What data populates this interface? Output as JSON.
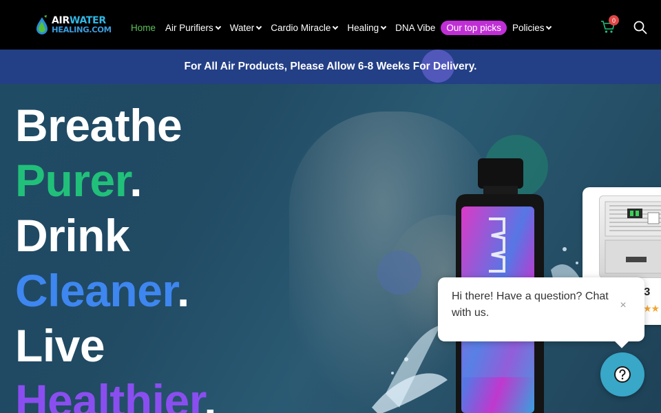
{
  "logo": {
    "line1_a": "AIR",
    "line1_b": "WATER",
    "line2": "HEALING.COM"
  },
  "nav": {
    "items": [
      {
        "label": "Home",
        "active": true,
        "dropdown": false
      },
      {
        "label": "Air Purifiers",
        "dropdown": true
      },
      {
        "label": "Water",
        "dropdown": true
      },
      {
        "label": "Cardio Miracle",
        "dropdown": true
      },
      {
        "label": "Healing",
        "dropdown": true
      },
      {
        "label": "DNA Vibe",
        "dropdown": false
      }
    ],
    "pill": "Our top picks",
    "policies": "Policies",
    "cart_count": "0"
  },
  "banner": {
    "text": "For All Air Products, Please Allow 6-8 Weeks For Delivery."
  },
  "hero": {
    "line1": "Breathe",
    "line2": "Purer",
    "line3": "Drink",
    "line4": "Cleaner",
    "line5": "Live",
    "line6": "Healthier",
    "dot": "."
  },
  "product_card": {
    "name": "r V3",
    "stars": "★★"
  },
  "chat": {
    "message": "Hi there! Have a question? Chat with us.",
    "close": "×"
  },
  "colors": {
    "accent_green": "#21c07a",
    "accent_blue": "#3e86f0",
    "accent_purple": "#8a4ef0",
    "pill": "#c02fd6",
    "banner": "#233f86",
    "nav_active": "#5fc25a"
  }
}
